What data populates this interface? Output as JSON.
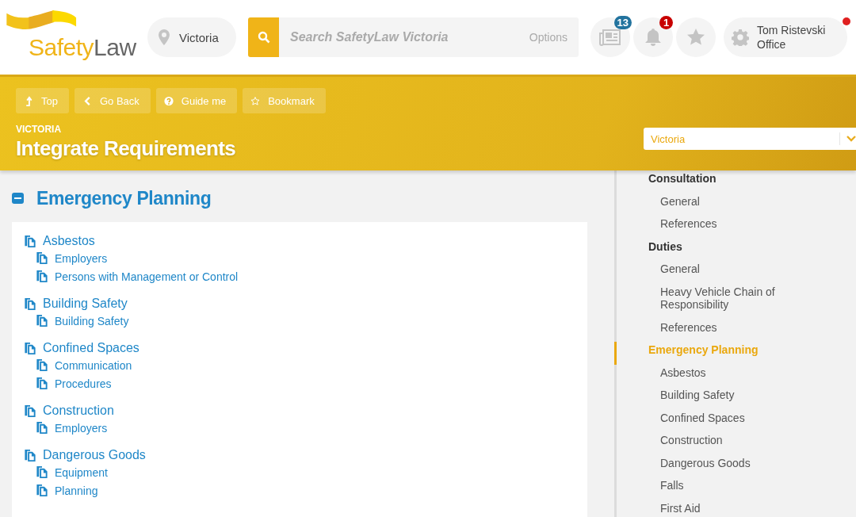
{
  "logo": {
    "text_1": "Safety",
    "text_2": "Law"
  },
  "location": {
    "label": "Victoria"
  },
  "search": {
    "placeholder": "Search SafetyLaw Victoria",
    "options": "Options"
  },
  "header_icons": [
    {
      "kind": "news",
      "badge": "13"
    },
    {
      "kind": "bell",
      "badge": "1"
    },
    {
      "kind": "star"
    }
  ],
  "user": {
    "name": "Tom Ristevski",
    "role": "Office",
    "notification": true
  },
  "toolbar": [
    {
      "kind": "top",
      "label": "Top"
    },
    {
      "kind": "back",
      "label": "Go Back"
    },
    {
      "kind": "guide",
      "label": "Guide me"
    },
    {
      "kind": "bookmark",
      "label": "Bookmark"
    }
  ],
  "page": {
    "region": "VICTORIA",
    "title": "Integrate Requirements"
  },
  "section": {
    "title": "Emergency Planning",
    "expanded": true
  },
  "topics": [
    {
      "title": "Asbestos",
      "children": [
        "Employers",
        "Persons with Management or Control"
      ]
    },
    {
      "title": "Building Safety",
      "children": [
        "Building Safety"
      ]
    },
    {
      "title": "Confined Spaces",
      "children": [
        "Communication",
        "Procedures"
      ]
    },
    {
      "title": "Construction",
      "children": [
        "Employers"
      ]
    },
    {
      "title": "Dangerous Goods",
      "children": [
        "Equipment",
        "Planning"
      ]
    }
  ],
  "jurisdiction_select": {
    "value": "Victoria"
  },
  "sidebar": {
    "items": [
      {
        "label": "Consultation",
        "selected": false,
        "children": [
          {
            "label": "General",
            "selected": false
          },
          {
            "label": "References",
            "selected": false
          }
        ]
      },
      {
        "label": "Duties",
        "selected": false,
        "children": [
          {
            "label": "General",
            "selected": false
          },
          {
            "label": "Heavy Vehicle Chain of Responsibility",
            "selected": false
          },
          {
            "label": "References",
            "selected": false
          }
        ]
      },
      {
        "label": "Emergency Planning",
        "selected": true,
        "children": [
          {
            "label": "Asbestos",
            "selected": false
          },
          {
            "label": "Building Safety",
            "selected": false
          },
          {
            "label": "Confined Spaces",
            "selected": false
          },
          {
            "label": "Construction",
            "selected": false
          },
          {
            "label": "Dangerous Goods",
            "selected": false
          },
          {
            "label": "Falls",
            "selected": false
          },
          {
            "label": "First Aid",
            "selected": false
          }
        ]
      }
    ]
  }
}
